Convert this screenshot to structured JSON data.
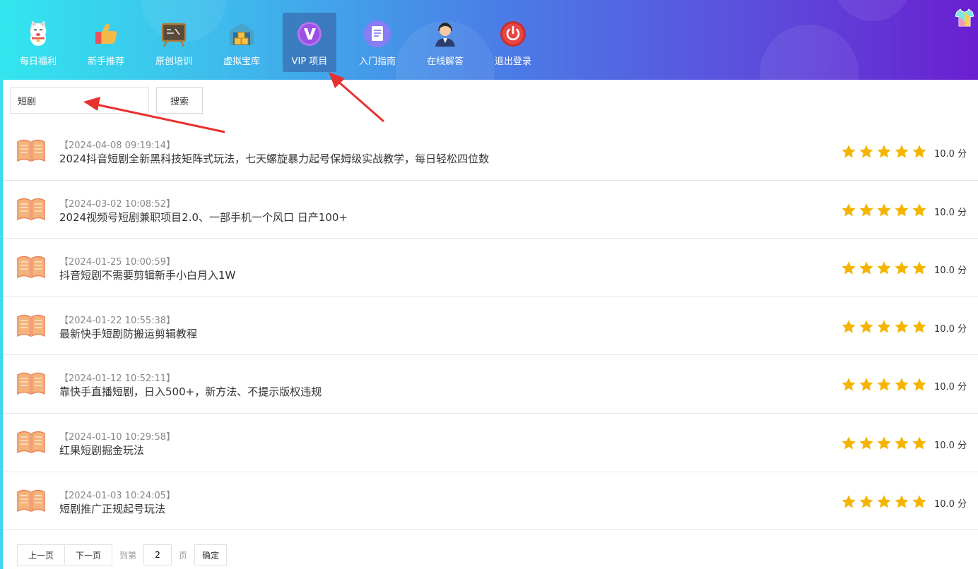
{
  "nav": [
    {
      "label": "每日福利",
      "icon": "lucky-cat-icon"
    },
    {
      "label": "新手推荐",
      "icon": "thumbs-up-icon"
    },
    {
      "label": "原创培训",
      "icon": "blackboard-icon"
    },
    {
      "label": "虚拟宝库",
      "icon": "warehouse-icon"
    },
    {
      "label": "VIP 项目",
      "icon": "vip-icon",
      "active": true
    },
    {
      "label": "入门指南",
      "icon": "document-icon"
    },
    {
      "label": "在线解答",
      "icon": "support-agent-icon"
    },
    {
      "label": "退出登录",
      "icon": "power-icon"
    }
  ],
  "search": {
    "value": "短剧",
    "button_label": "搜索"
  },
  "items": [
    {
      "date": "【2024-04-08 09:19:14】",
      "title": "2024抖音短剧全新黑科技矩阵式玩法，七天螺旋暴力起号保姆级实战教学，每日轻松四位数",
      "stars": 5,
      "score": "10.0 分"
    },
    {
      "date": "【2024-03-02 10:08:52】",
      "title": "2024视频号短剧兼职项目2.0、一部手机一个风口 日产100+",
      "stars": 5,
      "score": "10.0 分"
    },
    {
      "date": "【2024-01-25 10:00:59】",
      "title": "抖音短剧不需要剪辑新手小白月入1W",
      "stars": 5,
      "score": "10.0 分"
    },
    {
      "date": "【2024-01-22 10:55:38】",
      "title": "最新快手短剧防搬运剪辑教程",
      "stars": 5,
      "score": "10.0 分"
    },
    {
      "date": "【2024-01-12 10:52:11】",
      "title": "靠快手直播短剧，日入500+，新方法、不提示版权违规",
      "stars": 5,
      "score": "10.0 分"
    },
    {
      "date": "【2024-01-10 10:29:58】",
      "title": "红果短剧掘金玩法",
      "stars": 5,
      "score": "10.0 分"
    },
    {
      "date": "【2024-01-03 10:24:05】",
      "title": "短剧推广正规起号玩法",
      "stars": 5,
      "score": "10.0 分"
    }
  ],
  "pager": {
    "prev": "上一页",
    "next": "下一页",
    "goto_label": "到第",
    "page": "2",
    "page_unit": "页",
    "ok": "确定"
  },
  "colors": {
    "star": "#f5b400",
    "book": "#f3a35c"
  }
}
